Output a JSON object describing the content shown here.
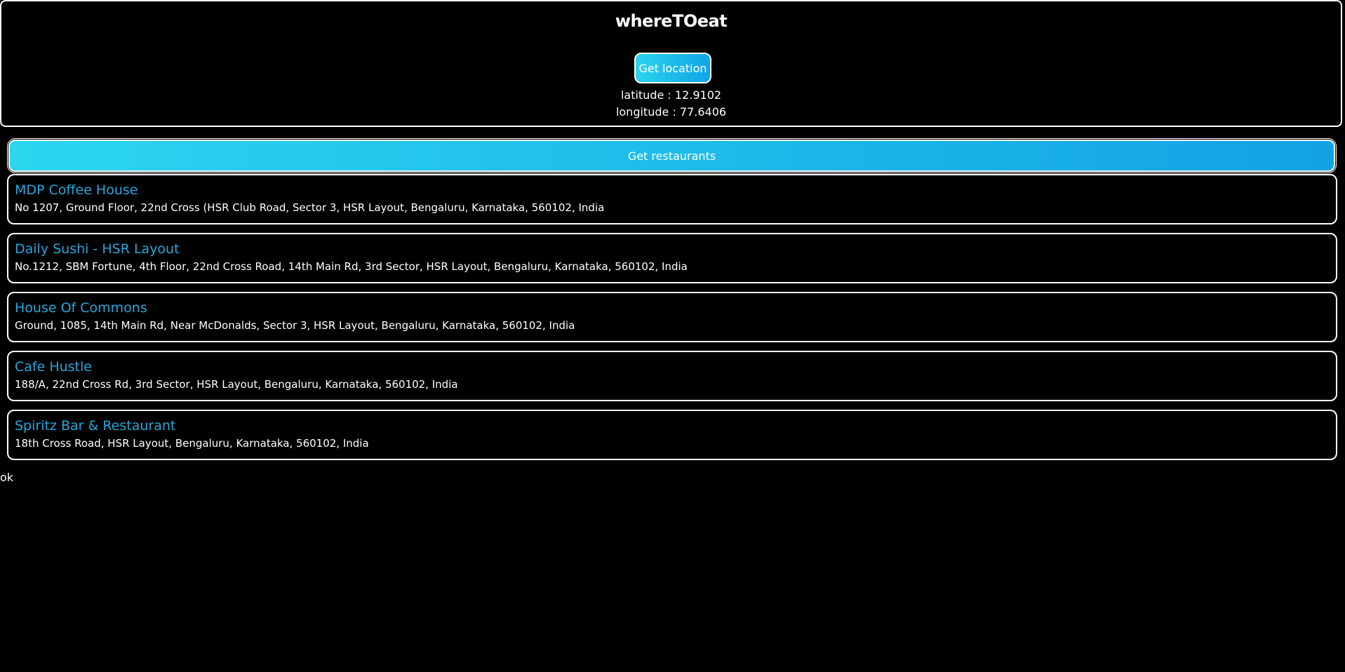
{
  "header": {
    "title": "whereTOeat",
    "get_location_label": "Get location",
    "latitude_text": "latitude : 12.9102",
    "longitude_text": "longitude : 77.6406"
  },
  "restaurants_button": {
    "label": "Get restaurants"
  },
  "restaurants": [
    {
      "name": "MDP Coffee House",
      "address": "No 1207, Ground Floor, 22nd Cross (HSR Club Road, Sector 3, HSR Layout, Bengaluru, Karnataka, 560102, India"
    },
    {
      "name": "Daily Sushi - HSR Layout",
      "address": "No.1212, SBM Fortune, 4th Floor, 22nd Cross Road, 14th Main Rd, 3rd Sector, HSR Layout, Bengaluru, Karnataka, 560102, India"
    },
    {
      "name": "House Of Commons",
      "address": "Ground, 1085, 14th Main Rd, Near McDonalds, Sector 3, HSR Layout, Bengaluru, Karnataka, 560102, India"
    },
    {
      "name": "Cafe Hustle",
      "address": "188/A, 22nd Cross Rd, 3rd Sector, HSR Layout, Bengaluru, Karnataka, 560102, India"
    },
    {
      "name": "Spiritz Bar & Restaurant",
      "address": "18th Cross Road, HSR Layout, Bengaluru, Karnataka, 560102, India"
    }
  ],
  "status": {
    "text": "ok"
  },
  "colors": {
    "background": "#000000",
    "accent_gradient_start": "#2bd4ee",
    "accent_gradient_end": "#12a4e6",
    "restaurant_name": "#22a8de",
    "text": "#ffffff"
  }
}
